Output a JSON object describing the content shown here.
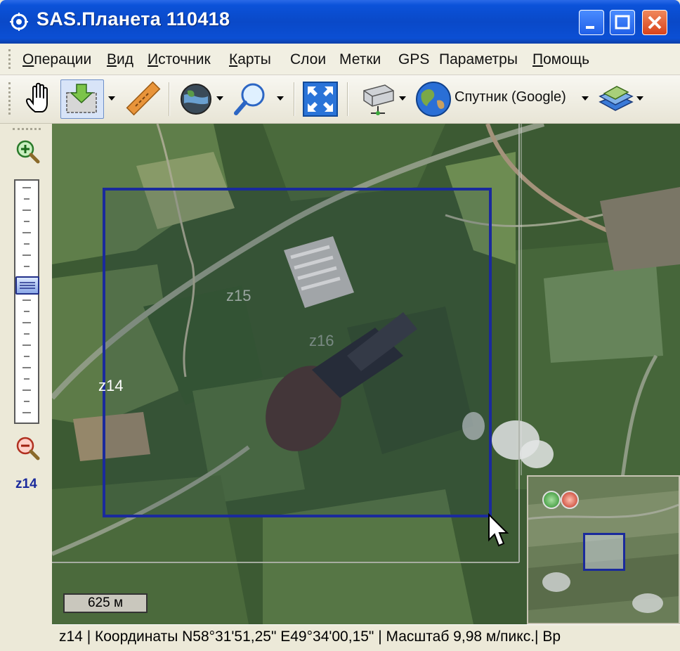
{
  "window": {
    "title": "SAS.Планета 110418"
  },
  "menu": {
    "items": [
      {
        "label": "Операции",
        "underline": "О"
      },
      {
        "label": "Вид",
        "underline": "В"
      },
      {
        "label": "Источник",
        "underline": "И"
      },
      {
        "label": "Карты",
        "underline": "К"
      },
      {
        "label": "Слои",
        "underline": ""
      },
      {
        "label": "Метки",
        "underline": ""
      },
      {
        "label": "GPS",
        "underline": ""
      },
      {
        "label": "Параметры",
        "underline": ""
      },
      {
        "label": "Помощь",
        "underline": "П"
      }
    ]
  },
  "toolbar": {
    "map_source": "Спутник (Google)",
    "icons": [
      "hand-icon",
      "download-selection-icon",
      "ruler-icon",
      "globe-layers-icon",
      "zoom-magnifier-icon",
      "fullscreen-icon",
      "tile-cache-icon",
      "google-globe-icon",
      "layers-icon"
    ]
  },
  "zoom_panel": {
    "current_zoom": "z14"
  },
  "map": {
    "overlay_labels": {
      "z14": "z14",
      "z15": "z15",
      "z16": "z16"
    },
    "scale": "625 м"
  },
  "statusbar": {
    "text": "z14 | Координаты N58°31'51,25\" E49°34'00,15\" | Масштаб 9,98 м/пикс.| Вр"
  },
  "colors": {
    "titlebar": "#0b52d9",
    "selection_frame": "#1a2a9c",
    "zoom_label": "#1a2a9c"
  }
}
